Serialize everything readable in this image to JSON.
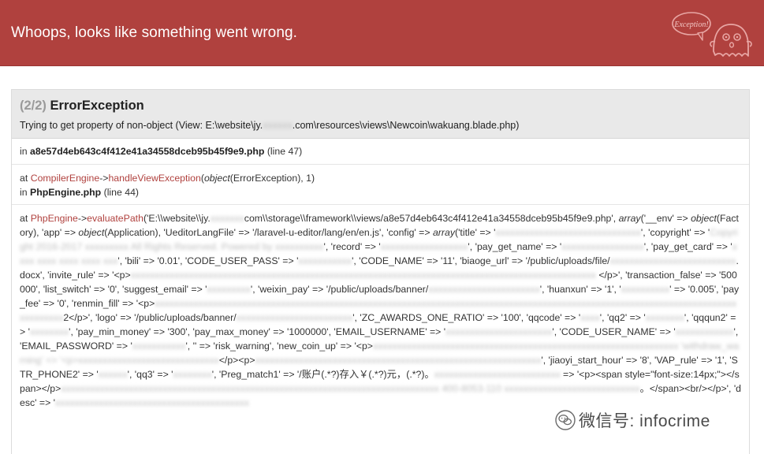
{
  "header": {
    "title": "Whoops, looks like something went wrong.",
    "logo_label": "Exception!"
  },
  "exception": {
    "count": "(2/2)",
    "type": "ErrorException",
    "message_prefix": "Trying to get property of non-object (View: E:\\website\\jy.",
    "message_blur": "xxxxxx",
    "message_suffix": ".com\\resources\\views\\Newcoin\\wakuang.blade.php)"
  },
  "trace1": {
    "prefix": "in",
    "file": "a8e57d4eb643c4f412e41a34558dceb95b45f9e9.php",
    "line": "(line 47)"
  },
  "trace2": {
    "at": "at",
    "class": "CompilerEngine",
    "arrow": "->",
    "method": "handleViewException",
    "args_open": "(",
    "arg_type": "object",
    "arg_rest": "(ErrorException), 1)",
    "in": "in",
    "file": "PhpEngine.php",
    "line": "(line 44)"
  },
  "trace3": {
    "at": "at",
    "class": "PhpEngine",
    "arrow": "->",
    "method": "evaluatePath",
    "segments": [
      {
        "t": "('E:\\\\website\\\\jy.",
        "s": "n"
      },
      {
        "t": "xxxxxxx",
        "s": "b"
      },
      {
        "t": "com\\\\storage\\\\framework\\\\views/a8e57d4eb643c4f412e41a34558dceb95b45f9e9.php', ",
        "s": "n"
      },
      {
        "t": "array",
        "s": "i"
      },
      {
        "t": "('__env' => ",
        "s": "n"
      },
      {
        "t": "object",
        "s": "i"
      },
      {
        "t": "(Factory), 'app' => ",
        "s": "n"
      },
      {
        "t": "object",
        "s": "i"
      },
      {
        "t": "(Application), 'UeditorLangFile' => '/laravel-u-editor/lang/en/en.js', 'config' => ",
        "s": "n"
      },
      {
        "t": "array",
        "s": "i"
      },
      {
        "t": "('title' => '",
        "s": "n"
      },
      {
        "t": "xxxxxxxxxxxxxxxxxxxxxxxxxxxxxx",
        "s": "b"
      },
      {
        "t": "', 'copyright' => '",
        "s": "n"
      },
      {
        "t": "Copyright 2016-2017 xxxxxxxxx All Rights Reserved. Powered by xxxxxxxxxx",
        "s": "b"
      },
      {
        "t": "', 'record' => '",
        "s": "n"
      },
      {
        "t": "xxxxxxxxxxxxxxxxxx",
        "s": "b"
      },
      {
        "t": "', 'pay_get_name' => '",
        "s": "n"
      },
      {
        "t": "xxxxxxxxxxxxxxxxx",
        "s": "b"
      },
      {
        "t": "', 'pay_get_card' => '",
        "s": "n"
      },
      {
        "t": "xxxx xxxx xxxx xxxx xxx",
        "s": "b"
      },
      {
        "t": "', 'bili' => '0.01', 'CODE_USER_PASS' => '",
        "s": "n"
      },
      {
        "t": "xxxxxxxxxxx",
        "s": "b"
      },
      {
        "t": "', 'CODE_NAME' => '11', 'biaoge_url' => '/public/uploads/file/",
        "s": "n"
      },
      {
        "t": "xxxxxxxxxxxxxxxxxxxxxxxxxx",
        "s": "b"
      },
      {
        "t": ".docx', 'invite_rule' => '<p>",
        "s": "n"
      },
      {
        "t": "xxxxxxxxxxxxxxxxxxxxxxxxxxxxxxxxxxxxxxxxxxxxxxxxxxxxxxxxxxxxxxxxxxxxxxxxxxxxxxxxxxxxxxxxxxxxxxxx",
        "s": "b"
      },
      {
        "t": " </p>', 'transaction_false' => '500000', 'list_switch' => '0', 'suggest_email' => '",
        "s": "n"
      },
      {
        "t": "xxxxxxxxx",
        "s": "b"
      },
      {
        "t": "', 'weixin_pay' => '/public/uploads/banner/",
        "s": "n"
      },
      {
        "t": "xxxxxxxxxxxxxxxxxxxxxxx",
        "s": "b"
      },
      {
        "t": "', 'huanxun' => '1', '",
        "s": "n"
      },
      {
        "t": "xxxxxxxxxx",
        "s": "b"
      },
      {
        "t": "' => '0.005', 'pay_fee' => '0', 'renmin_fill' => '<p>",
        "s": "n"
      },
      {
        "t": "xxxxxxxxxxxxxxxxxxxxxxxxxxxxxxxxxxxxxxxxxxxxxxxxxxxxxxxxxxxxxxxxxxxxxxxxxxxxxxxxxxxxxxxxxxxxxxxxxxxxxxxxxxxxxxxxxxxxxxxxxxxxxxxxx",
        "s": "b"
      },
      {
        "t": "2</p>', 'logo' => '/public/uploads/banner/",
        "s": "n"
      },
      {
        "t": "xxxxxxxxxxxxxxxxxxxxxxxx",
        "s": "b"
      },
      {
        "t": "', 'ZC_AWARDS_ONE_RATIO' => '100', 'qqcode' => '",
        "s": "n"
      },
      {
        "t": "xxxx",
        "s": "b"
      },
      {
        "t": "', 'qq2' => '",
        "s": "n"
      },
      {
        "t": "xxxxxxxx",
        "s": "b"
      },
      {
        "t": "', 'qqqun2' => '",
        "s": "n"
      },
      {
        "t": "xxxxxxxx",
        "s": "b"
      },
      {
        "t": "', 'pay_min_money' => '300', 'pay_max_money' => '1000000', 'EMAIL_USERNAME' => '",
        "s": "n"
      },
      {
        "t": "xxxxxxxxxxxxxxxxxxxxxx",
        "s": "b"
      },
      {
        "t": "', 'CODE_USER_NAME' => '",
        "s": "n"
      },
      {
        "t": "xxxxxxxxxxxx",
        "s": "b"
      },
      {
        "t": "', 'EMAIL_PASSWORD' => '",
        "s": "n"
      },
      {
        "t": "xxxxxxxxxxx",
        "s": "b"
      },
      {
        "t": "', '' => 'risk_warning', 'new_coin_up' => '<p>",
        "s": "n"
      },
      {
        "t": "xxxxxxxxxxxxxxxxxxxxxxxxxxxxxxxxxxxxxxxxxxxxxxxxxxxxxxxxxxxxxxx 'withdraw_warning' => '<p>xxxxxxxxxxxxxxxxxxxxxxxxxxxxx",
        "s": "b"
      },
      {
        "t": "</p><p>",
        "s": "n"
      },
      {
        "t": "xxxxxxxxxxxxxxxxxxxxxxxxxxxxxxxxxxxxxxxxxxxxxxxxxxxxxxxxxxx",
        "s": "b"
      },
      {
        "t": "', 'jiaoyi_start_hour' => '8', 'VAP_rule' => '1', 'STR_PHONE2' => '",
        "s": "n"
      },
      {
        "t": "xxxxxx",
        "s": "b"
      },
      {
        "t": "', 'qq3' => '",
        "s": "n"
      },
      {
        "t": "xxxxxxxx",
        "s": "b"
      },
      {
        "t": "', 'Preg_match1' => '/账户(.*?)存入￥(.*?)元，(.*?)。",
        "s": "n"
      },
      {
        "t": "xxxxxxxxxxxxxxxxxxxxxxxxxx",
        "s": "b"
      },
      {
        "t": " => '<p><span style=\"font-size:14px;\"></span></p>",
        "s": "n"
      },
      {
        "t": "xxxxxxxxxxxxxxxxxxxxxxxxxxxxxxxxxxxxxxxxxxxxxxxxxxxxxxxxxxxxxxxxxxxxxxxxxxxxxx 400-8053-110 xxxxxxxxxxxxxxxxxxxxxxxxxxxx",
        "s": "b"
      },
      {
        "t": "。</span><br/></p>', 'desc' => '",
        "s": "n"
      },
      {
        "t": "xxxxxxxxxxxxxxxxxxxxxxxxxxxxxxxxxxxxxxxx",
        "s": "b"
      }
    ]
  },
  "watermark": {
    "text": "微信号: infocrime"
  },
  "colors": {
    "header_bg": "#b0413e",
    "accent": "#b0413e",
    "panel_head_bg": "#e9e9e9"
  }
}
